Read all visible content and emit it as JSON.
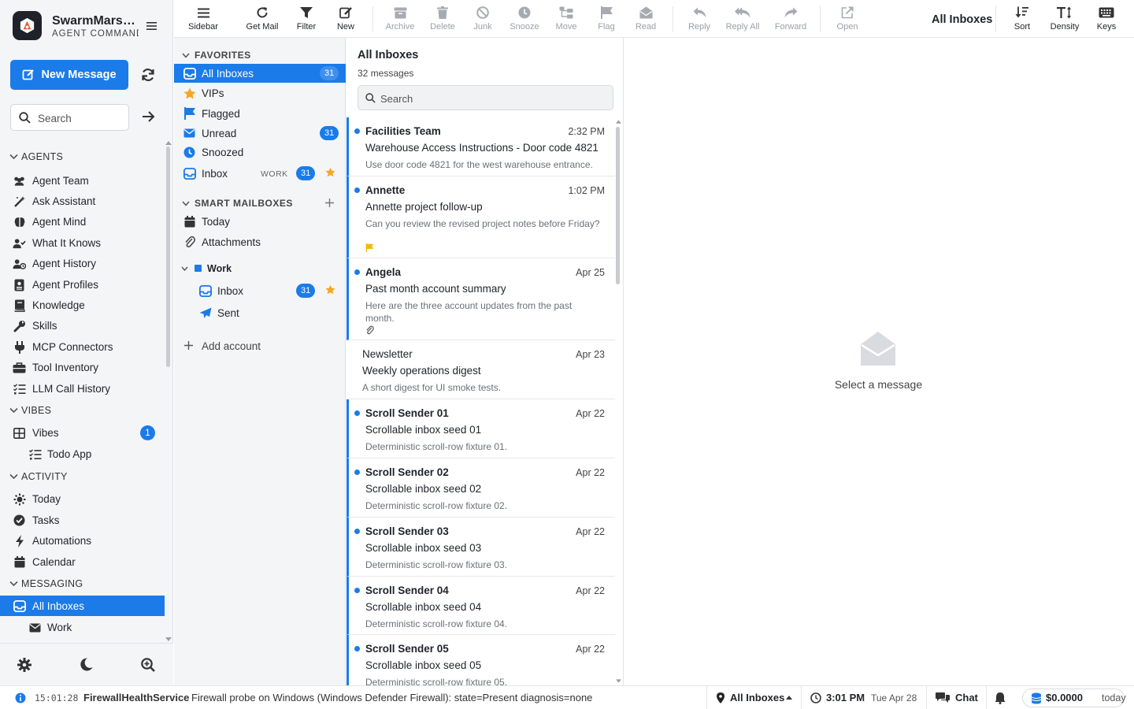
{
  "colors": {
    "accent": "#1b7be8",
    "star": "#f5a623",
    "flag": "#f2b705"
  },
  "brand": {
    "title": "SwarmMarshal",
    "subtitle": "AGENT COMMAND"
  },
  "sidebar": {
    "new_message": "New Message",
    "search_placeholder": "Search",
    "sections": {
      "agents": "AGENTS",
      "vibes": "VIBES",
      "activity": "ACTIVITY",
      "messaging": "MESSAGING"
    },
    "agents": [
      "Agent Team",
      "Ask Assistant",
      "Agent Mind",
      "What It Knows",
      "Agent History",
      "Agent Profiles",
      "Knowledge",
      "Skills",
      "MCP Connectors",
      "Tool Inventory",
      "LLM Call History"
    ],
    "vibes": {
      "label": "Vibes",
      "badge": "1",
      "child": "Todo App"
    },
    "activity": [
      "Today",
      "Tasks",
      "Automations",
      "Calendar"
    ],
    "messaging": [
      "All Inboxes",
      "Work"
    ]
  },
  "toolbar": {
    "items": [
      "Sidebar",
      "Get Mail",
      "Filter",
      "New",
      "Archive",
      "Delete",
      "Junk",
      "Snooze",
      "Move",
      "Flag",
      "Read",
      "Reply",
      "Reply All",
      "Forward",
      "Open"
    ],
    "title": "All Inboxes",
    "right": [
      "Sort",
      "Density",
      "Keys"
    ]
  },
  "folders": {
    "favorites_label": "FAVORITES",
    "favorites": [
      {
        "label": "All Inboxes",
        "badge": "31"
      },
      {
        "label": "VIPs"
      },
      {
        "label": "Flagged"
      },
      {
        "label": "Unread",
        "badge": "31"
      },
      {
        "label": "Snoozed"
      },
      {
        "label": "Inbox",
        "tag": "WORK",
        "badge": "31"
      }
    ],
    "smart_label": "SMART MAILBOXES",
    "smart": [
      "Today",
      "Attachments"
    ],
    "account": {
      "name": "Work",
      "inbox": "Inbox",
      "inbox_badge": "31",
      "sent": "Sent"
    },
    "add_account": "Add account"
  },
  "list": {
    "title": "All Inboxes",
    "count": "32 messages",
    "search_placeholder": "Search",
    "messages": [
      {
        "from": "Facilities Team",
        "date": "2:32 PM",
        "subject": "Warehouse Access Instructions - Door code 4821",
        "preview": "Use door code 4821 for the west warehouse entrance."
      },
      {
        "from": "Annette",
        "date": "1:02 PM",
        "subject": "Annette project follow-up",
        "preview": "Can you review the revised project notes before Friday?"
      },
      {
        "from": "Angela",
        "date": "Apr 25",
        "subject": "Past month account summary",
        "preview": "Here are the three account updates from the past month."
      },
      {
        "from": "Newsletter",
        "date": "Apr 23",
        "subject": "Weekly operations digest",
        "preview": "A short digest for UI smoke tests."
      },
      {
        "from": "Scroll Sender 01",
        "date": "Apr 22",
        "subject": "Scrollable inbox seed 01",
        "preview": "Deterministic scroll-row fixture 01."
      },
      {
        "from": "Scroll Sender 02",
        "date": "Apr 22",
        "subject": "Scrollable inbox seed 02",
        "preview": "Deterministic scroll-row fixture 02."
      },
      {
        "from": "Scroll Sender 03",
        "date": "Apr 22",
        "subject": "Scrollable inbox seed 03",
        "preview": "Deterministic scroll-row fixture 03."
      },
      {
        "from": "Scroll Sender 04",
        "date": "Apr 22",
        "subject": "Scrollable inbox seed 04",
        "preview": "Deterministic scroll-row fixture 04."
      },
      {
        "from": "Scroll Sender 05",
        "date": "Apr 22",
        "subject": "Scrollable inbox seed 05",
        "preview": "Deterministic scroll-row fixture 05."
      }
    ]
  },
  "preview": {
    "empty": "Select a message"
  },
  "status": {
    "time": "15:01:28",
    "service": "FirewallHealthService",
    "message": "Firewall probe on Windows (Windows Defender Firewall): state=Present diagnosis=none",
    "location": "All Inboxes",
    "clock": "3:01 PM",
    "date": "Tue Apr 28",
    "chat": "Chat",
    "cost": "$0.0000",
    "cost_period": "today"
  }
}
